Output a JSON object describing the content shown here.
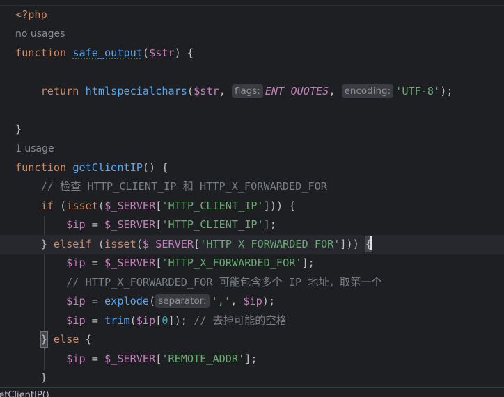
{
  "editor": {
    "language": "php",
    "hints": {
      "no_usages": "no usages",
      "one_usage": "1 usage",
      "flags": "flags:",
      "encoding": "encoding:",
      "separator": "separator:"
    },
    "tokens": {
      "php_open": "<?php",
      "function_kw": "function",
      "return_kw": "return",
      "if_kw": "if",
      "elseif_kw": "elseif",
      "else_kw": "else",
      "isset_fn": "isset",
      "safe_output_name": "safe_output",
      "get_client_ip_name": "getClientIP",
      "htmlspecialchars_fn": "htmlspecialchars",
      "explode_fn": "explode",
      "trim_fn": "trim",
      "var_str": "$str",
      "var_ip": "$ip",
      "var_server": "$_SERVER",
      "const_ent_quotes": "ENT_QUOTES",
      "str_utf8": "'UTF-8'",
      "str_client_ip": "'HTTP_CLIENT_IP'",
      "str_forwarded_for": "'HTTP_X_FORWARDED_FOR'",
      "str_remote_addr": "'REMOTE_ADDR'",
      "str_comma": "','",
      "num_zero": "0",
      "comment_check": "// 检查 HTTP_CLIENT_IP 和 HTTP_X_FORWARDED_FOR",
      "comment_multi_ip": "// HTTP_X_FORWARDED_FOR 可能包含多个 IP 地址，取第一个",
      "comment_trim": "// 去掉可能的空格"
    },
    "breadcrumb": "getClientIP()"
  },
  "colors": {
    "background": "#1e1f22",
    "keyword": "#cf8e6d",
    "function": "#56a8f5",
    "variable": "#c77dbb",
    "string": "#6aab73",
    "comment": "#7a7e85",
    "number": "#2aacb8",
    "default_text": "#bcbec4",
    "inlay_hint_bg": "#393b40",
    "current_line": "#26282e"
  }
}
